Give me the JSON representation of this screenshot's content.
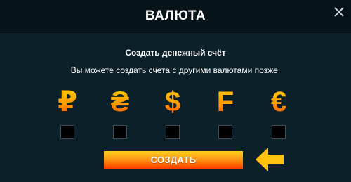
{
  "modal": {
    "title": "ВАЛЮТА",
    "close_icon": "close-icon"
  },
  "content": {
    "subtitle": "Создать денежный счёт",
    "description": "Вы можете создать счета с другими валютами позже."
  },
  "currencies": [
    {
      "symbol": "₽",
      "icon": "ruble-icon",
      "checked": false
    },
    {
      "symbol": "₴",
      "icon": "hryvnia-icon",
      "checked": false
    },
    {
      "symbol": "$",
      "icon": "dollar-icon",
      "checked": false
    },
    {
      "symbol": "F",
      "icon": "franc-icon",
      "checked": false
    },
    {
      "symbol": "€",
      "icon": "euro-icon",
      "checked": false
    }
  ],
  "actions": {
    "create_label": "СОЗДАТЬ"
  },
  "colors": {
    "background": "#0c202a",
    "header_background": "#07141a",
    "accent_orange": "#ff8a00",
    "accent_yellow": "#ffd200",
    "pointer_arrow": "#ffc20e"
  },
  "decorations": {
    "pointer_icon": "arrow-left-icon"
  }
}
